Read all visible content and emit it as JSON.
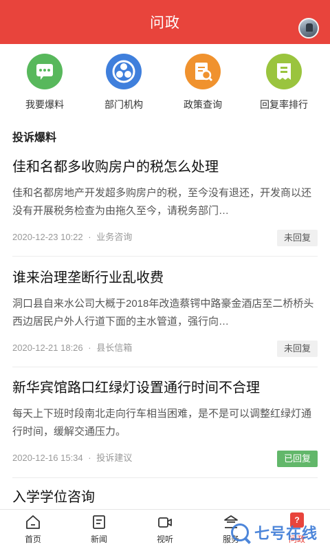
{
  "header": {
    "title": "问政"
  },
  "quick_actions": [
    {
      "label": "我要爆料",
      "icon": "chat-bubble-icon",
      "color": "#58b85c"
    },
    {
      "label": "部门机构",
      "icon": "organization-icon",
      "color": "#3f7fdc"
    },
    {
      "label": "政策查询",
      "icon": "document-search-icon",
      "color": "#f0922e"
    },
    {
      "label": "回复率排行",
      "icon": "ranking-receipt-icon",
      "color": "#9ac43e"
    }
  ],
  "section": {
    "title": "投诉爆料"
  },
  "news": [
    {
      "title": "佳和名都多收购房户的税怎么处理",
      "summary": "佳和名都房地产开发超多购房户的税，至今没有退还，开发商以还没有开展税务检查为由拖久至今，请税务部门…",
      "date": "2020-12-23 10:22",
      "category": "业务咨询",
      "status": "未回复"
    },
    {
      "title": "谁来治理垄断行业乱收费",
      "summary": "洞口县自来水公司大概于2018年改造蔡锷中路豪金酒店至二桥桥头西边居民户外人行道下面的主水管道，强行向…",
      "date": "2020-12-21 18:26",
      "category": "县长信箱",
      "status": "未回复"
    },
    {
      "title": "新华宾馆路口红绿灯设置通行时间不合理",
      "summary": "每天上下班时段南北走向行车相当困难，是不是可以调整红绿灯通行时间，缓解交通压力。",
      "date": "2020-12-16 15:34",
      "category": "投诉建议",
      "status": "已回复"
    },
    {
      "title": "入学学位咨询"
    }
  ],
  "meta_separator": "·",
  "tabs": [
    {
      "label": "首页",
      "icon": "home-icon"
    },
    {
      "label": "新闻",
      "icon": "news-icon"
    },
    {
      "label": "视听",
      "icon": "video-icon"
    },
    {
      "label": "服务",
      "icon": "service-icon"
    },
    {
      "label": "问政",
      "icon": "question-icon",
      "badge": "?"
    }
  ],
  "watermark": {
    "text": "七号在线"
  },
  "colors": {
    "brand_red": "#e8443c",
    "replied_green": "#62b76a"
  }
}
